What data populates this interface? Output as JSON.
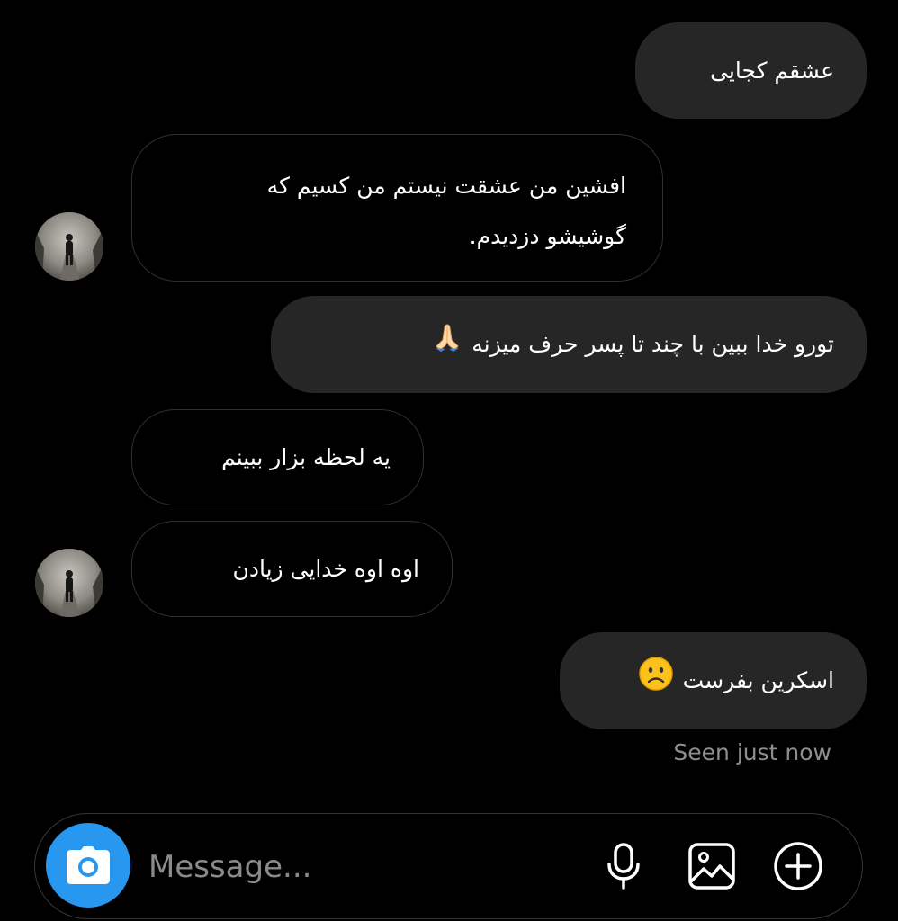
{
  "messages": [
    {
      "direction": "sent",
      "text": "عشقم کجایی"
    },
    {
      "direction": "received",
      "lines": [
        "افشین من عشقت نیستم من کسیم که",
        "گوشیشو دزدیدم."
      ]
    },
    {
      "direction": "sent",
      "text": "تورو خدا ببین با چند تا پسر حرف میزنه",
      "emoji": "🙏"
    },
    {
      "direction": "received",
      "text": "یه لحظه بزار ببینم"
    },
    {
      "direction": "received",
      "text": "اوه اوه خدایی زیادن"
    },
    {
      "direction": "sent",
      "text": "اسکرین بفرست",
      "emoji": "☹"
    }
  ],
  "status": {
    "seen": "Seen just now"
  },
  "composer": {
    "placeholder": "Message...",
    "icons": [
      "camera-icon",
      "microphone-icon",
      "image-icon",
      "plus-circle-icon"
    ]
  },
  "colors": {
    "background": "#000000",
    "sent_bubble": "#262626",
    "received_border": "#2f2f2f",
    "accent_blue": "#2797f0",
    "seen_text": "#8e8e8e"
  }
}
